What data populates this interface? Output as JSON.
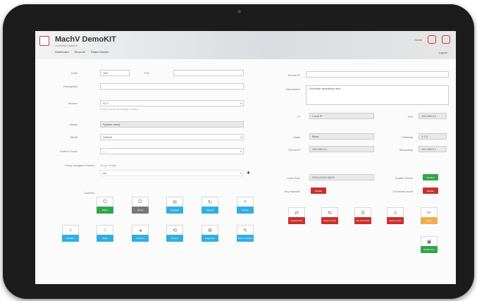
{
  "header": {
    "title": "MachV DemoKIT",
    "subtitle": "controller platform",
    "nav": [
      "Dashboard",
      "Show All",
      "Status Monitor"
    ],
    "right_links": [
      "Home",
      "Settings",
      "Logout"
    ]
  },
  "left_form": {
    "row1_label": "Code",
    "row1_value": "100",
    "row1_label2": "Prio",
    "desc_label": "Description",
    "version_label": "Version",
    "version_value": "V2.7",
    "version_hint": "Firmware version and hardware revision",
    "status_label": "Status",
    "status_value": "System ready",
    "mode_label": "Mode",
    "mode_value": "Default",
    "group_label": "Control Group",
    "group_value": "---",
    "assign_label": "Group assigned Device",
    "assign_radio": "Group   Single",
    "assign_value": "All",
    "controls_label": "Controls"
  },
  "tiles_left": [
    {
      "name": "offline",
      "label": "Offline",
      "icon": "⏻",
      "color": "green"
    },
    {
      "name": "off",
      "label": "Off All",
      "icon": "⏻",
      "color": "grey"
    },
    {
      "name": "message",
      "label": "Message",
      "icon": "✉",
      "color": "blue"
    },
    {
      "name": "refresh",
      "label": "Refresh",
      "icon": "↻",
      "color": "blue"
    },
    {
      "name": "volume",
      "label": "Volume",
      "icon": "+",
      "color": "blue"
    },
    {
      "name": "speaker",
      "label": "Speaker",
      "icon": "♪",
      "color": "blue"
    },
    {
      "name": "main",
      "label": "Main",
      "icon": "⌂",
      "color": "blue"
    },
    {
      "name": "channel",
      "label": "Channel",
      "icon": "◂",
      "color": "blue"
    },
    {
      "name": "reboot",
      "label": "Reboot",
      "icon": "⟲",
      "color": "blue"
    },
    {
      "name": "diagnostic",
      "label": "Diagnostic",
      "icon": "⚙",
      "color": "blue"
    },
    {
      "name": "device-settings",
      "label": "Device Settings",
      "icon": "✎",
      "color": "blue"
    }
  ],
  "right_form": {
    "device_id_label": "Device ID",
    "description_label": "Description",
    "description_value": "Controller description text",
    "ip_label": "IP",
    "ip_value": "Local IP",
    "ip2_label": "Port",
    "ip2_value": "192.168.0.1",
    "mask_label": "Mask",
    "mask_value": "Mask",
    "gateway_label": "Gateway",
    "gateway_value": "1.1.0",
    "dns_label": "Server IP",
    "dns_value": "192.168.0.1",
    "dns2_label": "Secondary",
    "dns2_value": "192.168.0.1",
    "time_label": "Local Time",
    "time_value": "2016-09-09 08:00",
    "enable_label": "Enable device",
    "enable_value": "Enabled",
    "key_label": "Key enabled",
    "key_value": "Disable",
    "autoreset_label": "Autoreset mode",
    "autoreset_value": "Disable"
  },
  "tiles_right": [
    {
      "name": "restart",
      "label": "Restart CPU",
      "icon": "⇄",
      "color": "red"
    },
    {
      "name": "reset-cfg",
      "label": "Reset Config",
      "icon": "⇆",
      "color": "red"
    },
    {
      "name": "get-status",
      "label": "Get Full Status",
      "icon": "☰",
      "color": "red"
    },
    {
      "name": "factory-reset",
      "label": "Factory reset",
      "icon": "⚠",
      "color": "red"
    },
    {
      "name": "tools",
      "label": "Tools",
      "icon": "✂",
      "color": "orange"
    },
    {
      "name": "update",
      "label": "Update firm",
      "icon": "▣",
      "color": "green"
    }
  ]
}
